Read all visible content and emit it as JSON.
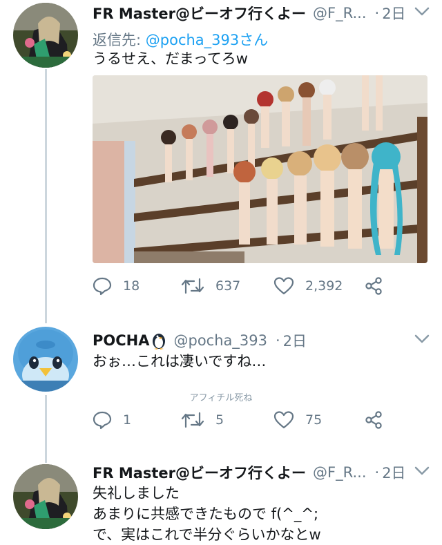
{
  "tweets": [
    {
      "author": "FR Master@ビーオフ行くよー",
      "handle": "@F_R...",
      "time_sep": "·",
      "time": "2日",
      "reply_label": "返信先:",
      "reply_mention": "@pocha_393さん",
      "text": [
        "うるせえ、だまってろw"
      ],
      "reply_count": "18",
      "retweet_count": "637",
      "like_count": "2,392"
    },
    {
      "author": "POCHA",
      "handle": "@pocha_393",
      "time_sep": "·",
      "time": "2日",
      "text": [
        "おぉ…これは凄いですね…"
      ],
      "caption": "アフィチル死ね",
      "reply_count": "1",
      "retweet_count": "5",
      "like_count": "75"
    },
    {
      "author": "FR Master@ビーオフ行くよー",
      "handle": "@F_R...",
      "time_sep": "·",
      "time": "2日",
      "text": [
        "失礼しました",
        "あまりに共感できたもので f(^_^;",
        "で、実はこれで半分ぐらいかなとw"
      ]
    }
  ],
  "colors": {
    "accent": "#1da1f2",
    "muted": "#657786",
    "thread_line": "#ccd6dd"
  },
  "icons": [
    "reply-icon",
    "retweet-icon",
    "like-icon",
    "share-icon",
    "chevron-down-icon",
    "penguin-emoji-icon"
  ]
}
